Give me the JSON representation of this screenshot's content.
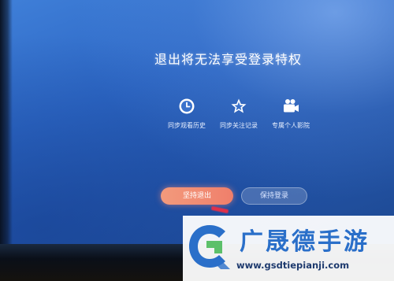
{
  "dialog": {
    "title": "退出将无法享受登录特权",
    "perks": [
      {
        "icon": "clock-icon",
        "label": "同步观看历史"
      },
      {
        "icon": "star-icon",
        "label": "同步关注记录"
      },
      {
        "icon": "video-camera-icon",
        "label": "专属个人影院"
      }
    ],
    "buttons": {
      "confirm_exit": "坚持退出",
      "keep_login": "保持登录"
    }
  },
  "watermark": {
    "brand": "广晟德手游",
    "url": "www.gsdtiepianji.com"
  }
}
